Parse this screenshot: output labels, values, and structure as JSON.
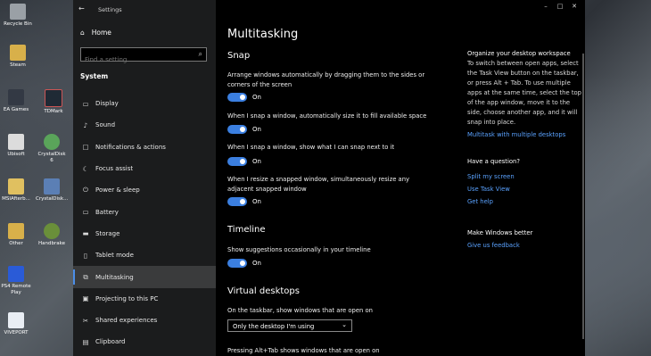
{
  "desktop": {
    "icons": [
      {
        "label": "Recycle Bin",
        "color": "#9aa0a6"
      },
      {
        "label": "Steam",
        "color": "#d8b04a"
      },
      {
        "label": "EA Games",
        "color": "#333944"
      },
      {
        "label": "TDMark",
        "color": "#1f2a35"
      },
      {
        "label": "Ubisoft",
        "color": "#dcdcdc"
      },
      {
        "label": "CrystalDisk 6",
        "color": "#5aa45a"
      },
      {
        "label": "MSIAfterb...",
        "color": "#e0c060"
      },
      {
        "label": "CrystalDisk...",
        "color": "#5b7fb5"
      },
      {
        "label": "Other",
        "color": "#d8b04a"
      },
      {
        "label": "Handbrake",
        "color": "#6a8f3a"
      },
      {
        "label": "PS4 Remote Play",
        "color": "#2a5bd7"
      },
      {
        "label": "VIVEPORT",
        "color": "#e9eef4"
      }
    ]
  },
  "window": {
    "title": "Settings",
    "controls": [
      "–",
      "□",
      "✕"
    ]
  },
  "sidebar": {
    "home_label": "Home",
    "search_placeholder": "Find a setting",
    "section_title": "System",
    "items": [
      {
        "label": "Display",
        "icon": "display-icon",
        "glyph": "▭"
      },
      {
        "label": "Sound",
        "icon": "sound-icon",
        "glyph": "♪"
      },
      {
        "label": "Notifications & actions",
        "icon": "notifications-icon",
        "glyph": "▢"
      },
      {
        "label": "Focus assist",
        "icon": "focus-assist-icon",
        "glyph": "☾"
      },
      {
        "label": "Power & sleep",
        "icon": "power-icon",
        "glyph": "⏻"
      },
      {
        "label": "Battery",
        "icon": "battery-icon",
        "glyph": "▭"
      },
      {
        "label": "Storage",
        "icon": "storage-icon",
        "glyph": "▬"
      },
      {
        "label": "Tablet mode",
        "icon": "tablet-mode-icon",
        "glyph": "▯"
      },
      {
        "label": "Multitasking",
        "icon": "multitasking-icon",
        "glyph": "⧉",
        "active": true
      },
      {
        "label": "Projecting to this PC",
        "icon": "projecting-icon",
        "glyph": "▣"
      },
      {
        "label": "Shared experiences",
        "icon": "shared-experiences-icon",
        "glyph": "✂"
      },
      {
        "label": "Clipboard",
        "icon": "clipboard-icon",
        "glyph": "▤"
      }
    ]
  },
  "main": {
    "page_title": "Multitasking",
    "snap": {
      "heading": "Snap",
      "items": [
        {
          "text": "Arrange windows automatically by dragging them to the sides or corners of the screen",
          "state": "On"
        },
        {
          "text": "When I snap a window, automatically size it to fill available space",
          "state": "On"
        },
        {
          "text": "When I snap a window, show what I can snap next to it",
          "state": "On"
        },
        {
          "text": "When I resize a snapped window, simultaneously resize any adjacent snapped window",
          "state": "On"
        }
      ]
    },
    "timeline": {
      "heading": "Timeline",
      "items": [
        {
          "text": "Show suggestions occasionally in your timeline",
          "state": "On"
        }
      ]
    },
    "virtual_desktops": {
      "heading": "Virtual desktops",
      "taskbar_label": "On the taskbar, show windows that are open on",
      "taskbar_value": "Only the desktop I'm using",
      "alttab_label": "Pressing Alt+Tab shows windows that are open on"
    }
  },
  "right_panel": {
    "organize_heading": "Organize your desktop workspace",
    "organize_text": "To switch between open apps, select the Task View button on the taskbar, or press Alt + Tab. To use multiple apps at the same time, select the top of the app window, move it to the side, choose another app, and it will snap into place.",
    "organize_link": "Multitask with multiple desktops",
    "question_heading": "Have a question?",
    "question_links": [
      "Split my screen",
      "Use Task View",
      "Get help"
    ],
    "better_heading": "Make Windows better",
    "better_link": "Give us feedback"
  },
  "colors": {
    "accent": "#3b7fe0",
    "link": "#5aa2ff",
    "sidebar_bg": "#1b1c1d",
    "content_bg": "#000000"
  }
}
